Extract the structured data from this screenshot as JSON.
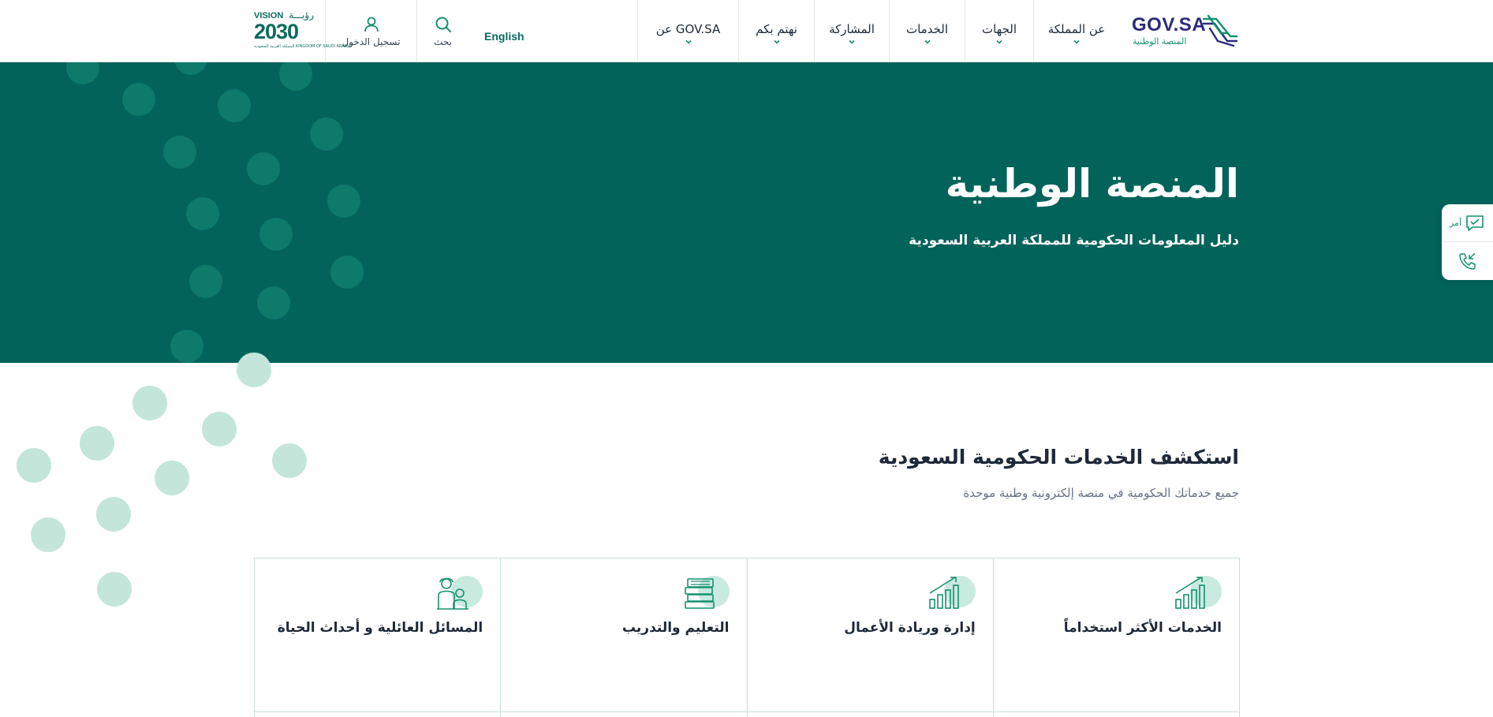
{
  "header": {
    "logo": {
      "brand": "GOV.SA",
      "subtitle": "المنصة الوطنية"
    },
    "nav": [
      {
        "label": "عن المملكة",
        "icon": "chevron-down-icon"
      },
      {
        "label": "الجهات",
        "icon": "chevron-down-icon"
      },
      {
        "label": "الخدمات",
        "icon": "chevron-down-icon"
      },
      {
        "label": "المشاركة",
        "icon": "chevron-down-icon"
      },
      {
        "label": "نهتم بكم",
        "icon": "chevron-down-icon"
      },
      {
        "label": "عن GOV.SA",
        "icon": "chevron-down-icon"
      }
    ],
    "language_label": "English",
    "search": {
      "label": "بحث",
      "icon": "search-icon"
    },
    "login": {
      "label": "تسجيل الدخول",
      "icon": "user-icon"
    },
    "vision": {
      "line1": "VISION",
      "line1_ar": "رؤيـــة",
      "year": "2030",
      "caption": "المملكة العربية السعودية KINGDOM OF SAUDI ARABIA"
    }
  },
  "hero": {
    "title": "المنصة الوطنية",
    "subtitle": "دليل المعلومات الحكومية للمملكة العربية السعودية",
    "background_color": "#02635b"
  },
  "side_widget": {
    "amr_label": "آمر",
    "amr_icon": "chat-icon",
    "call_icon": "phone-call-icon"
  },
  "explore": {
    "title": "استكشف الخدمات الحكومية السعودية",
    "subtitle": "جميع خدماتك الحكومية في منصة إلكترونية وطنية موحدة",
    "cards": [
      {
        "label": "الخدمات الأكثر استخداماً",
        "icon": "bar-chart-growth-icon"
      },
      {
        "label": "إدارة وريادة الأعمال",
        "icon": "bar-chart-growth-icon"
      },
      {
        "label": "التعليم والتدريب",
        "icon": "books-stack-icon"
      },
      {
        "label": "المسائل العائلية و أحداث الحياة",
        "icon": "family-icon"
      }
    ]
  },
  "colors": {
    "primary": "#02635b",
    "accent": "#14916e",
    "brand_navy": "#2b2a7a",
    "dot_dark": "#0d7a6a",
    "dot_light": "#c3e5da"
  }
}
